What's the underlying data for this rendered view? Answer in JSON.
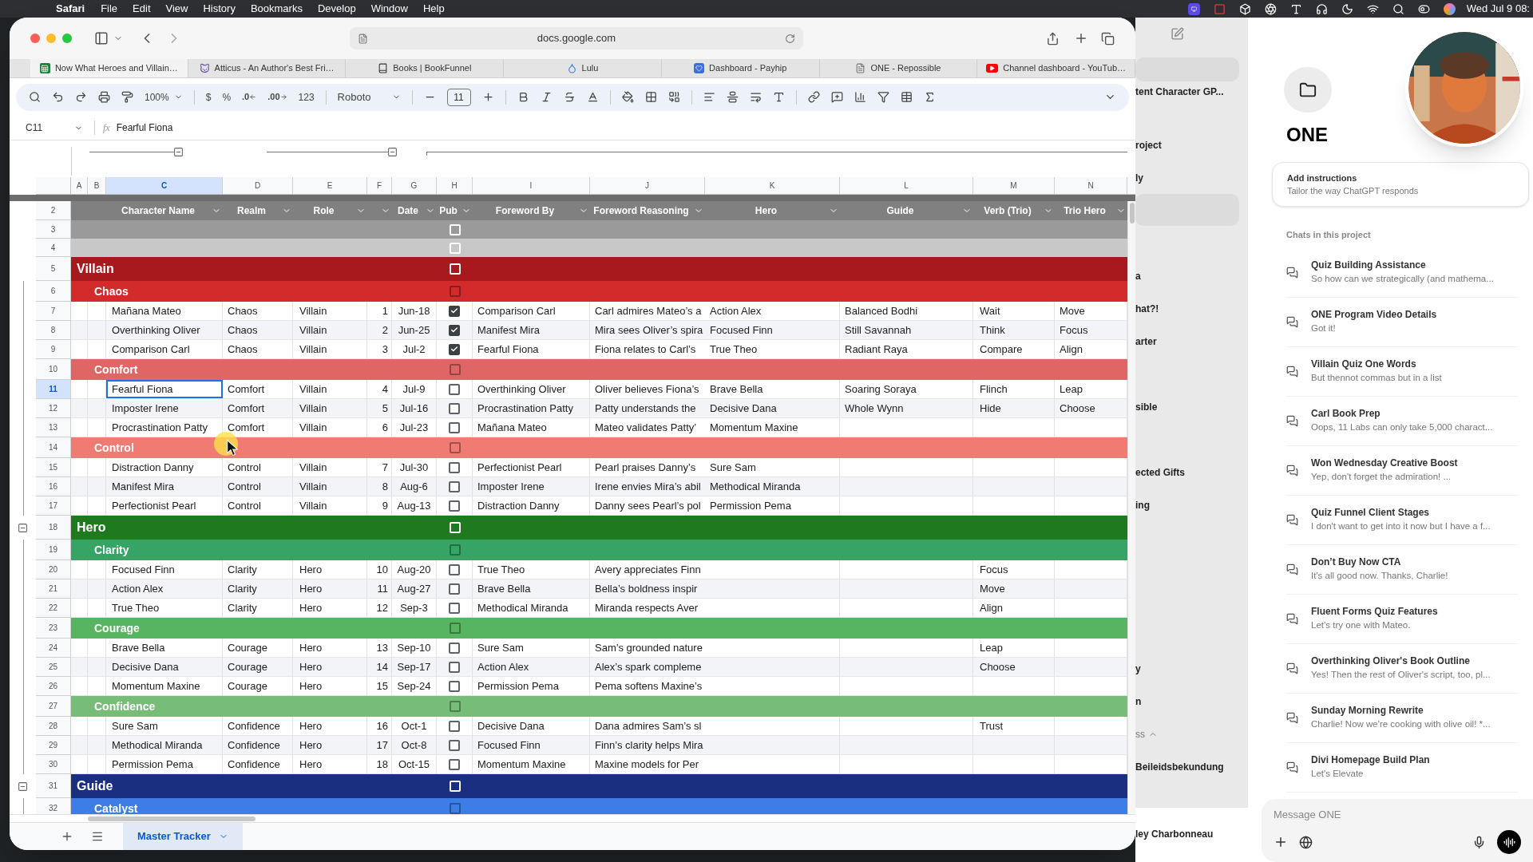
{
  "menubar": {
    "app": "Safari",
    "menus": [
      "File",
      "Edit",
      "View",
      "History",
      "Bookmarks",
      "Develop",
      "Window",
      "Help"
    ],
    "clock": "Wed Jul 9 08:"
  },
  "browser": {
    "url": "docs.google.com",
    "tabs": [
      {
        "title": "Now What Heroes and Villain…",
        "selected": true
      },
      {
        "title": "Atticus - An Author's Best Fri…",
        "selected": false
      },
      {
        "title": "Books | BookFunnel",
        "selected": false
      },
      {
        "title": "Lulu",
        "selected": false
      },
      {
        "title": "Dashboard - Payhip",
        "selected": false
      },
      {
        "title": "ONE - Repossible",
        "selected": false
      },
      {
        "title": "Channel dashboard - YouTub…",
        "selected": false
      }
    ]
  },
  "sheet": {
    "toolbar": {
      "zoom": "100%",
      "currency": "$",
      "percent": "%",
      "decrease_decimals": ".0",
      "increase_decimals": ".00",
      "number_format": "123",
      "font": "Roboto",
      "font_size": "11"
    },
    "formula_bar": {
      "cell": "C11",
      "function_label": "fx",
      "value": "Fearful Fiona"
    },
    "columns": [
      {
        "letter": "A",
        "selected": false
      },
      {
        "letter": "B",
        "selected": false
      },
      {
        "letter": "C",
        "selected": true,
        "heading": "Character Name"
      },
      {
        "letter": "D",
        "selected": false,
        "heading": "Realm"
      },
      {
        "letter": "E",
        "selected": false,
        "heading": "Role"
      },
      {
        "letter": "F",
        "selected": false
      },
      {
        "letter": "G",
        "selected": false,
        "heading": "Date"
      },
      {
        "letter": "H",
        "selected": false,
        "heading": "Pub"
      },
      {
        "letter": "I",
        "selected": false,
        "heading": "Foreword By"
      },
      {
        "letter": "J",
        "selected": false,
        "heading": "Foreword Reasoning"
      },
      {
        "letter": "K",
        "selected": false,
        "heading": "Hero"
      },
      {
        "letter": "L",
        "selected": false,
        "heading": "Guide"
      },
      {
        "letter": "M",
        "selected": false,
        "heading": "Verb (Trio)"
      },
      {
        "letter": "N",
        "selected": false,
        "heading": "Trio Hero"
      }
    ],
    "rows": [
      {
        "number": "2",
        "kind": "header",
        "selected": false
      },
      {
        "number": "3",
        "kind": "blank",
        "color": "#9a9a9a",
        "pub": false,
        "selected": false
      },
      {
        "number": "4",
        "kind": "blank",
        "color": "#c8c8c8",
        "pub": false,
        "selected": false
      },
      {
        "number": "5",
        "kind": "category",
        "label": "Villain",
        "color": "#a8191d",
        "pub": false,
        "toggle": false,
        "selected": false
      },
      {
        "number": "6",
        "kind": "subcategory",
        "label": "Chaos",
        "color": "#d32b2b",
        "pub": false,
        "selected": false
      },
      {
        "number": "7",
        "kind": "item",
        "name": "Mañana Mateo",
        "realm": "Chaos",
        "role": "Villain",
        "no": "1",
        "date": "Jun-18",
        "pub": true,
        "foreword_by": "Comparison Carl",
        "reasoning": "Carl admires Mateo’s a",
        "hero": "Action Alex",
        "guide": "Balanced Bodhi",
        "verb": "Wait",
        "trio_hero": "Move",
        "selected": false
      },
      {
        "number": "8",
        "kind": "item",
        "name": "Overthinking Oliver",
        "realm": "Chaos",
        "role": "Villain",
        "no": "2",
        "date": "Jun-25",
        "pub": true,
        "foreword_by": "Manifest Mira",
        "reasoning": "Mira sees Oliver’s spira",
        "hero": "Focused Finn",
        "guide": "Still Savannah",
        "verb": "Think",
        "trio_hero": "Focus",
        "selected": false
      },
      {
        "number": "9",
        "kind": "item",
        "name": "Comparison Carl",
        "realm": "Chaos",
        "role": "Villain",
        "no": "3",
        "date": "Jul-2",
        "pub": true,
        "foreword_by": "Fearful Fiona",
        "reasoning": "Fiona relates to Carl’s",
        "hero": "True Theo",
        "guide": "Radiant Raya",
        "verb": "Compare",
        "trio_hero": "Align",
        "selected": false
      },
      {
        "number": "10",
        "kind": "subcategory",
        "label": "Comfort",
        "color": "#e06666",
        "pub": false,
        "selected": false
      },
      {
        "number": "11",
        "kind": "item",
        "name": "Fearful Fiona",
        "realm": "Comfort",
        "role": "Villain",
        "no": "4",
        "date": "Jul-9",
        "pub": false,
        "foreword_by": "Overthinking Oliver",
        "reasoning": "Oliver believes Fiona’s",
        "hero": "Brave Bella",
        "guide": "Soaring Soraya",
        "verb": "Flinch",
        "trio_hero": "Leap",
        "selected": true
      },
      {
        "number": "12",
        "kind": "item",
        "name": "Imposter Irene",
        "realm": "Comfort",
        "role": "Villain",
        "no": "5",
        "date": "Jul-16",
        "pub": false,
        "foreword_by": "Procrastination Patty",
        "reasoning": "Patty understands the",
        "hero": "Decisive Dana",
        "guide": "Whole Wynn",
        "verb": "Hide",
        "trio_hero": "Choose",
        "selected": false
      },
      {
        "number": "13",
        "kind": "item",
        "name": "Procrastination Patty",
        "realm": "Comfort",
        "role": "Villain",
        "no": "6",
        "date": "Jul-23",
        "pub": false,
        "foreword_by": "Mañana Mateo",
        "reasoning": "Mateo validates Patty’",
        "hero": "Momentum Maxine",
        "selected": false
      },
      {
        "number": "14",
        "kind": "subcategory",
        "label": "Control",
        "color": "#ef7b72",
        "pub": false,
        "selected": false
      },
      {
        "number": "15",
        "kind": "item",
        "name": "Distraction Danny",
        "realm": "Control",
        "role": "Villain",
        "no": "7",
        "date": "Jul-30",
        "pub": false,
        "foreword_by": "Perfectionist Pearl",
        "reasoning": "Pearl praises Danny’s",
        "hero": "Sure Sam",
        "selected": false
      },
      {
        "number": "16",
        "kind": "item",
        "name": "Manifest Mira",
        "realm": "Control",
        "role": "Villain",
        "no": "8",
        "date": "Aug-6",
        "pub": false,
        "foreword_by": "Imposter Irene",
        "reasoning": "Irene envies Mira’s abil",
        "hero": "Methodical Miranda",
        "selected": false
      },
      {
        "number": "17",
        "kind": "item",
        "name": "Perfectionist Pearl",
        "realm": "Control",
        "role": "Villain",
        "no": "9",
        "date": "Aug-13",
        "pub": false,
        "foreword_by": "Distraction Danny",
        "reasoning": "Danny sees Pearl’s pol",
        "hero": "Permission Pema",
        "selected": false
      },
      {
        "number": "18",
        "kind": "category",
        "label": "Hero",
        "color": "#1f7a1f",
        "pub": false,
        "toggle": true,
        "selected": false
      },
      {
        "number": "19",
        "kind": "subcategory",
        "label": "Clarity",
        "color": "#35a464",
        "pub": false,
        "selected": false
      },
      {
        "number": "20",
        "kind": "item",
        "name": "Focused Finn",
        "realm": "Clarity",
        "role": "Hero",
        "no": "10",
        "date": "Aug-20",
        "pub": false,
        "foreword_by": "True Theo",
        "reasoning": "Avery appreciates Finn",
        "verb": "Focus",
        "selected": false
      },
      {
        "number": "21",
        "kind": "item",
        "name": "Action Alex",
        "realm": "Clarity",
        "role": "Hero",
        "no": "11",
        "date": "Aug-27",
        "pub": false,
        "foreword_by": "Brave Bella",
        "reasoning": "Bella’s boldness inspir",
        "verb": "Move",
        "selected": false
      },
      {
        "number": "22",
        "kind": "item",
        "name": "True Theo",
        "realm": "Clarity",
        "role": "Hero",
        "no": "12",
        "date": "Sep-3",
        "pub": false,
        "foreword_by": "Methodical Miranda",
        "reasoning": "Miranda respects Aver",
        "verb": "Align",
        "selected": false
      },
      {
        "number": "23",
        "kind": "subcategory",
        "label": "Courage",
        "color": "#57b460",
        "pub": false,
        "selected": false
      },
      {
        "number": "24",
        "kind": "item",
        "name": "Brave Bella",
        "realm": "Courage",
        "role": "Hero",
        "no": "13",
        "date": "Sep-10",
        "pub": false,
        "foreword_by": "Sure Sam",
        "reasoning": "Sam’s grounded nature",
        "verb": "Leap",
        "selected": false
      },
      {
        "number": "25",
        "kind": "item",
        "name": "Decisive Dana",
        "realm": "Courage",
        "role": "Hero",
        "no": "14",
        "date": "Sep-17",
        "pub": false,
        "foreword_by": "Action Alex",
        "reasoning": "Alex’s spark compleme",
        "verb": "Choose",
        "selected": false
      },
      {
        "number": "26",
        "kind": "item",
        "name": "Momentum Maxine",
        "realm": "Courage",
        "role": "Hero",
        "no": "15",
        "date": "Sep-24",
        "pub": false,
        "foreword_by": "Permission Pema",
        "reasoning": "Pema softens Maxine’s",
        "selected": false
      },
      {
        "number": "27",
        "kind": "subcategory",
        "label": "Confidence",
        "color": "#77bc77",
        "pub": false,
        "selected": false
      },
      {
        "number": "28",
        "kind": "item",
        "name": "Sure Sam",
        "realm": "Confidence",
        "role": "Hero",
        "no": "16",
        "date": "Oct-1",
        "pub": false,
        "foreword_by": "Decisive Dana",
        "reasoning": "Dana admires Sam’s sl",
        "verb": "Trust",
        "selected": false
      },
      {
        "number": "29",
        "kind": "item",
        "name": "Methodical Miranda",
        "realm": "Confidence",
        "role": "Hero",
        "no": "17",
        "date": "Oct-8",
        "pub": false,
        "foreword_by": "Focused Finn",
        "reasoning": "Finn’s clarity helps Mira",
        "selected": false
      },
      {
        "number": "30",
        "kind": "item",
        "name": "Permission Pema",
        "realm": "Confidence",
        "role": "Hero",
        "no": "18",
        "date": "Oct-15",
        "pub": false,
        "foreword_by": "Momentum Maxine",
        "reasoning": "Maxine models for Per",
        "selected": false
      },
      {
        "number": "31",
        "kind": "category",
        "label": "Guide",
        "color": "#1b2f80",
        "pub": false,
        "toggle": true,
        "selected": false
      },
      {
        "number": "32",
        "kind": "subcategory",
        "label": "Catalyst",
        "color": "#3c7ee6",
        "pub": false,
        "selected": false
      }
    ],
    "sheet_tabs": [
      {
        "label": "Master Tracker",
        "selected": true
      }
    ]
  },
  "project_sidebar": {
    "top_item": "tent Character GP...",
    "items": [
      {
        "label": "roject",
        "kind": "chat"
      },
      {
        "label": "ly",
        "kind": "chat"
      },
      {
        "label": "a",
        "kind": "chat"
      },
      {
        "label": "hat?!",
        "kind": "chat"
      },
      {
        "label": "arter",
        "kind": "chat"
      },
      {
        "label": "sible",
        "kind": "chat"
      },
      {
        "label": "ected Gifts",
        "kind": "chat"
      },
      {
        "label": "ing",
        "kind": "chat"
      },
      {
        "label": "y",
        "kind": "chat"
      },
      {
        "label": "n",
        "kind": "chat"
      },
      {
        "label": "ss",
        "kind": "section"
      },
      {
        "label": "Beileidsbekundung",
        "kind": "chat"
      }
    ],
    "account_name": "ley Charbonneau"
  },
  "project": {
    "title": "ONE",
    "instructions": {
      "title": "Add instructions",
      "subtitle": "Tailor the way ChatGPT responds"
    },
    "chats_heading": "Chats in this project",
    "chats": [
      {
        "title": "Quiz Building Assistance",
        "preview": "So how can we strategically (and mathema..."
      },
      {
        "title": "ONE Program Video Details",
        "preview": "Got it!"
      },
      {
        "title": "Villain Quiz One Words",
        "preview": "But thennot commas but in a list"
      },
      {
        "title": "Carl Book Prep",
        "preview": "Oops, 11 Labs can only take 5,000 charact..."
      },
      {
        "title": "Won Wednesday Creative Boost",
        "preview": "Yep, don't forget the admiration! ..."
      },
      {
        "title": "Quiz Funnel Client Stages",
        "preview": "I don't want to get into it now but I have a f..."
      },
      {
        "title": "Don’t Buy Now CTA",
        "preview": "It's all good now. Thanks, Charlie!"
      },
      {
        "title": "Fluent Forms Quiz Features",
        "preview": "Let’s try one with Mateo."
      },
      {
        "title": "Overthinking Oliver's Book Outline",
        "preview": "Yes! Then the rest of Oliver's script, too, pl..."
      },
      {
        "title": "Sunday Morning Rewrite",
        "preview": "Charlie! Now we're cooking with olive oil! *..."
      },
      {
        "title": "Divi Homepage Build Plan",
        "preview": "Let's Elevate"
      }
    ],
    "message_placeholder": "Message ONE"
  }
}
